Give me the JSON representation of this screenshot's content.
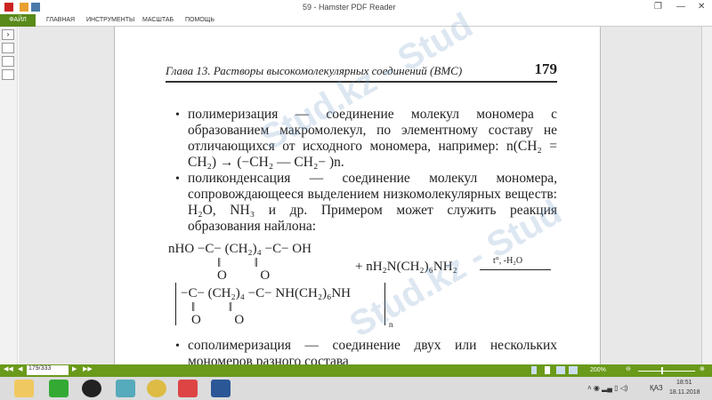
{
  "window": {
    "title": "59 - Hamster PDF Reader"
  },
  "menu": [
    "ФАЙЛ",
    "ГЛАВНАЯ",
    "ИНСТРУМЕНТЫ",
    "МАСШТАБ",
    "ПОМОЩЬ"
  ],
  "page": {
    "header": "Глава 13. Растворы высокомолекулярных соединений (ВМС)",
    "number": "179",
    "bullet1": "полимеризация — соединение молекул мономера с образованием макромолекул, по элементному составу не отличающихся от исходного мономера, например: n(CH₂ = CH₂) → (−CH₂ — CH₂− )n.",
    "bullet2": "поликонденсация — соединение молекул мономера, сопровождающееся выделением низкомолекулярных веществ: H₂O, NH₃ и др. Примером может служить реакция образования найлона:",
    "eq1": "nHO −C− (CH₂)₄ −C− OH",
    "eq1o": "‖          ‖",
    "eq1oo": "O          O",
    "eq2": "+ nH₂N(CH₂)₆NH₂",
    "eq_cond": "t°, -H₂O",
    "eq3": "−C− (CH₂)₄ −C− NH(CH₂)₆NH",
    "eq3n": "n",
    "bullet3": "сополимеризация — соединение двух или нескольких мономеров разного состава",
    "watermark": "Stud.kz - Stud"
  },
  "status": {
    "page_value": "179/333",
    "zoom": "200%"
  },
  "tray": {
    "lang": "ҚАЗ",
    "time": "18:51",
    "date": "18.11.2018"
  }
}
